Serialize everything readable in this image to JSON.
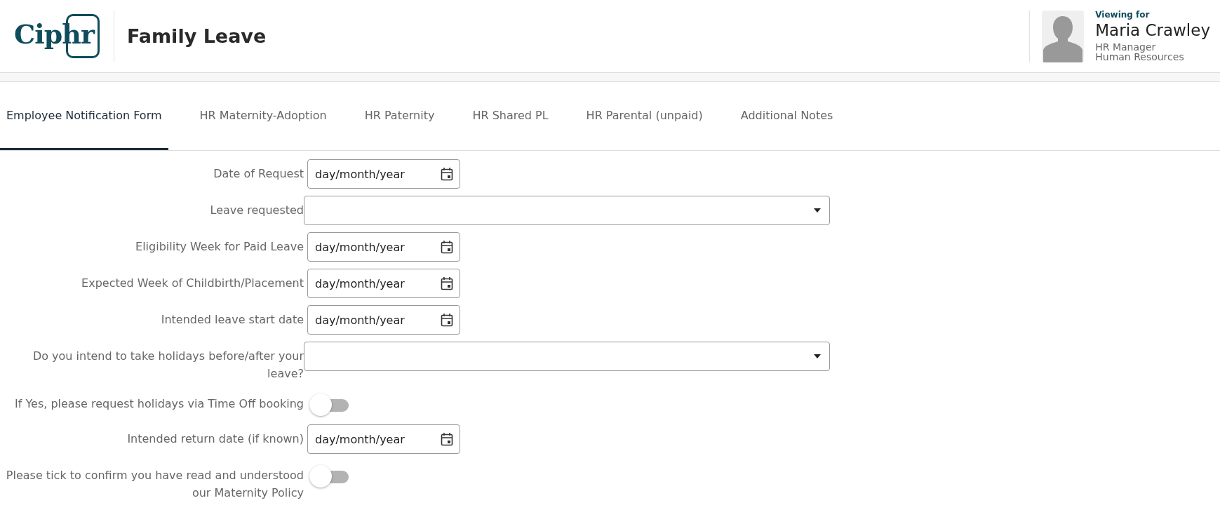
{
  "header": {
    "logo": "Ciphr",
    "title": "Family Leave",
    "viewing_label": "Viewing for",
    "person_name": "Maria Crawley",
    "person_role": "HR Manager",
    "person_department": "Human Resources"
  },
  "tabs": [
    {
      "label": "Employee Notification Form",
      "selected": true
    },
    {
      "label": "HR Maternity-Adoption",
      "selected": false
    },
    {
      "label": "HR Paternity",
      "selected": false
    },
    {
      "label": "HR Shared PL",
      "selected": false
    },
    {
      "label": "HR Parental (unpaid)",
      "selected": false
    },
    {
      "label": "Additional Notes",
      "selected": false
    }
  ],
  "form": [
    {
      "kind": "date",
      "label": "Date of Request",
      "placeholder": "day/month/year"
    },
    {
      "kind": "select",
      "label": "Leave requested"
    },
    {
      "kind": "date",
      "label": "Eligibility Week for Paid Leave",
      "placeholder": "day/month/year"
    },
    {
      "kind": "date",
      "label": "Expected Week of Childbirth/Placement",
      "placeholder": "day/month/year"
    },
    {
      "kind": "date",
      "label": "Intended leave start date",
      "placeholder": "day/month/year"
    },
    {
      "kind": "select",
      "label": "Do you intend to take holidays before/after your leave?"
    },
    {
      "kind": "toggle",
      "label": "If Yes, please request holidays via Time Off booking",
      "on": false
    },
    {
      "kind": "date",
      "label": "Intended return date (if known)",
      "placeholder": "day/month/year"
    },
    {
      "kind": "toggle",
      "label": "Please tick to confirm you have read and understood our Maternity Policy",
      "on": false
    }
  ]
}
